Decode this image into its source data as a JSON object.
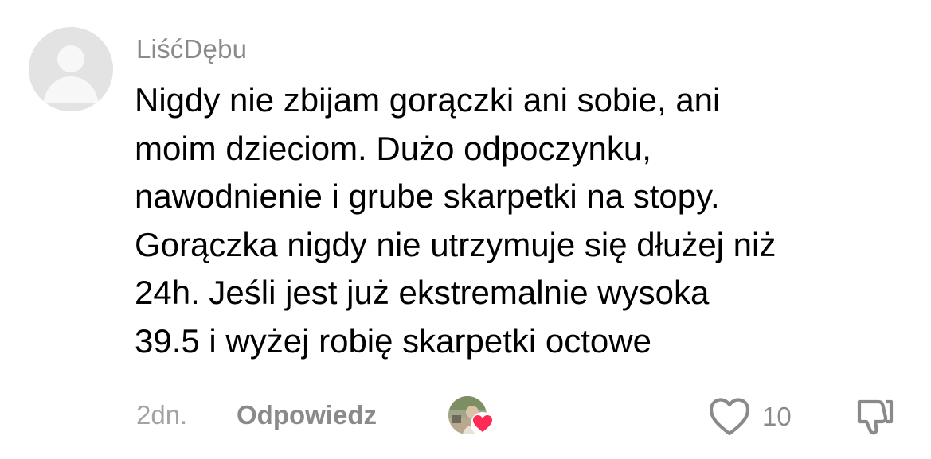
{
  "comment": {
    "username": "LiśćDębu",
    "lines": [
      "Nigdy nie zbijam gorączki ani sobie, ani",
      "moim dzieciom. Dużo odpoczynku,",
      "nawodnienie i grube skarpetki na stopy.",
      "Gorączka nigdy nie utrzymuje się dłużej niż",
      "24h. Jeśli jest już ekstremalnie wysoka",
      "39.5 i wyżej robię skarpetki octowe"
    ],
    "time": "2dn.",
    "reply_label": "Odpowiedz",
    "like_count": "10",
    "icons": {
      "avatar": "default-avatar-icon",
      "creator_like": "creator-liked-avatar-icon",
      "like": "heart-outline-icon",
      "dislike": "thumbs-down-outline-icon"
    },
    "colors": {
      "username": "#8a8a8a",
      "text": "#000000",
      "muted": "#a3a3a3",
      "heart_badge": "#fe2c55"
    }
  }
}
